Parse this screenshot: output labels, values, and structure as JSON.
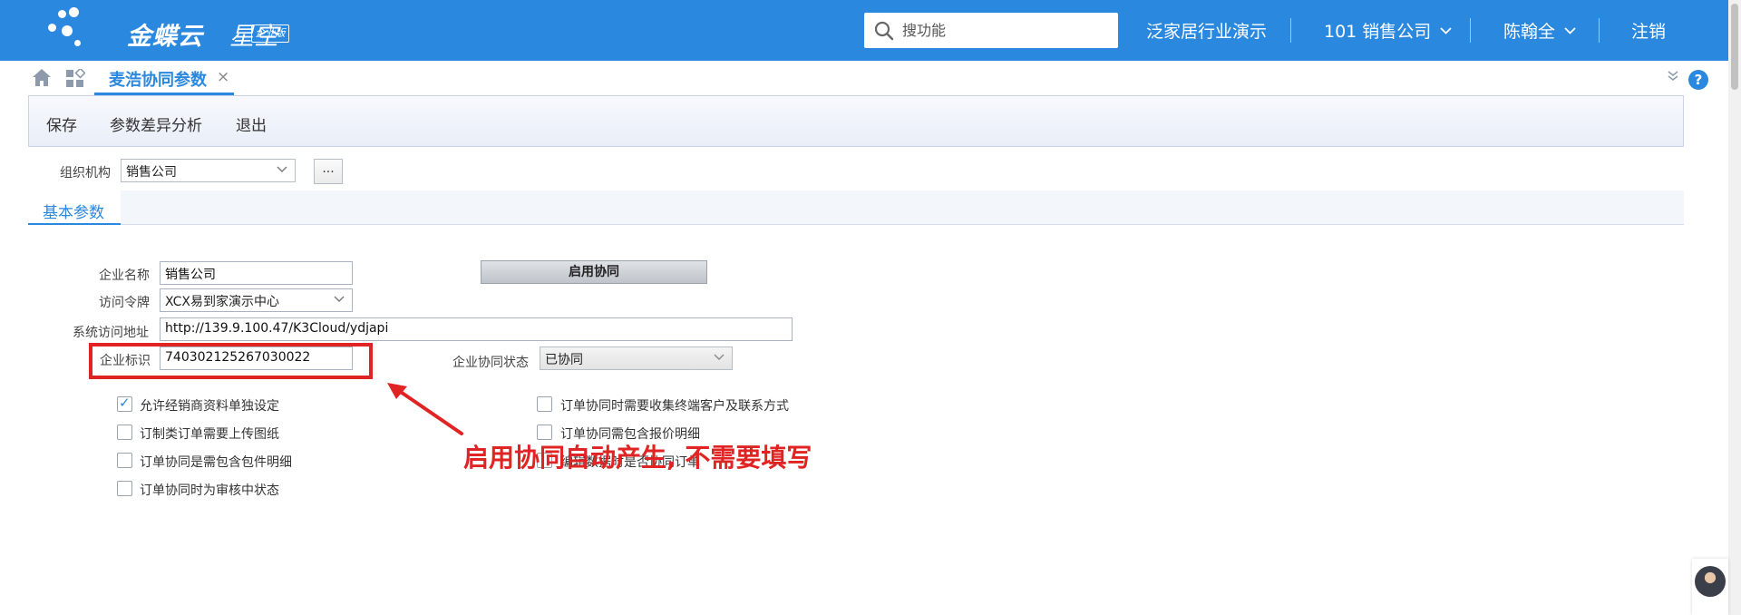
{
  "app": {
    "brand": "金蝶云",
    "brand_sub": "星空",
    "badge": "企业版"
  },
  "header": {
    "search_placeholder": "搜功能",
    "tenant": "泛家居行业演示",
    "org": "101 销售公司",
    "user": "陈翰全",
    "logout": "注销"
  },
  "tabs": {
    "active_label": "麦浩协同参数",
    "close_glyph": "×",
    "help_glyph": "?"
  },
  "toolbar": {
    "save": "保存",
    "diff": "参数差异分析",
    "exit": "退出"
  },
  "org_row": {
    "label": "组织机构",
    "value": "销售公司",
    "more_button": "..."
  },
  "section": {
    "tab_label": "基本参数"
  },
  "form": {
    "company_name_label": "企业名称",
    "company_name_value": "销售公司",
    "token_label": "访问令牌",
    "token_value": "XCX易到家演示中心",
    "url_label": "系统访问地址",
    "url_value": "http://139.9.100.47/K3Cloud/ydjapi",
    "corp_id_label": "企业标识",
    "corp_id_value": "740302125267030022",
    "status_label": "企业协同状态",
    "status_value": "已协同",
    "enable_button": "启用协同"
  },
  "checkboxes_left": [
    {
      "label": "允许经销商资料单独设定",
      "checked": true
    },
    {
      "label": "订制类订单需要上传图纸",
      "checked": false
    },
    {
      "label": "订单协同是需包含包件明细",
      "checked": false
    },
    {
      "label": "订单协同时为审核中状态",
      "checked": false
    }
  ],
  "checkboxes_right": [
    {
      "label": "订单协同时需要收集终端客户及联系方式",
      "checked": false
    },
    {
      "label": "订单协同需包含报价明细",
      "checked": false
    },
    {
      "label": "编辑数据时是否协同订单",
      "checked": false
    }
  ],
  "annotation": {
    "note": "启用协同自动产生, 不需要填写",
    "color": "#e02323"
  },
  "colors": {
    "brand_blue": "#2b88df",
    "toolbar_bg": "#e9eef8"
  }
}
